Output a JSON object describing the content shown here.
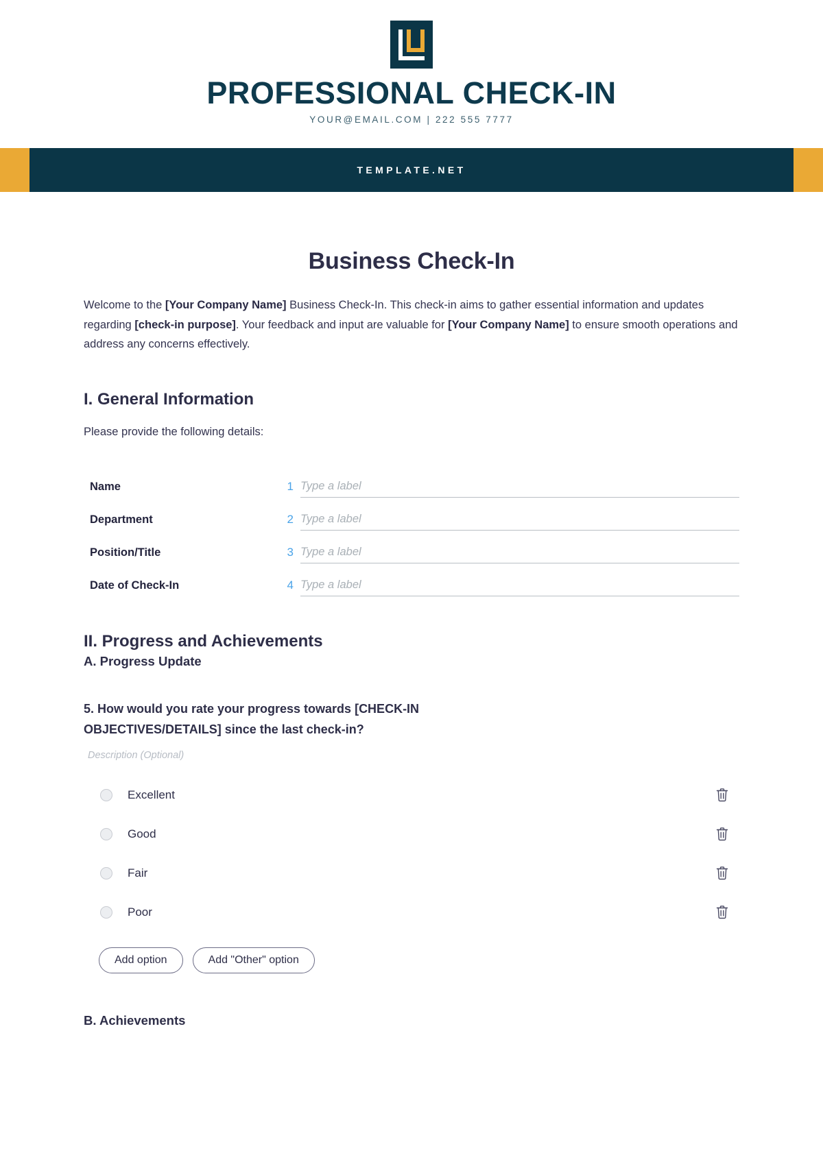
{
  "brand": {
    "logo_icon": "lu-monogram-logo",
    "title": "PROFESSIONAL CHECK-IN",
    "contact": "YOUR@EMAIL.COM | 222 555 7777"
  },
  "banner": {
    "text": "TEMPLATE.NET",
    "bar_color": "#0b3647",
    "accent_color": "#eaa935"
  },
  "document": {
    "title": "Business Check-In",
    "intro": {
      "p1": "Welcome to the ",
      "b1": "[Your Company Name]",
      "p2": " Business Check-In. This check-in aims to gather essential information and updates regarding ",
      "b2": "[check-in purpose]",
      "p3": ". Your feedback and input are valuable for ",
      "b3": "[Your Company Name]",
      "p4": " to ensure smooth operations and address any concerns effectively."
    }
  },
  "section_one": {
    "heading": "I. General Information",
    "subtitle": "Please provide the following details:",
    "fields": [
      {
        "label": "Name",
        "number": "1",
        "placeholder": "Type a label",
        "value": ""
      },
      {
        "label": "Department",
        "number": "2",
        "placeholder": "Type a label",
        "value": ""
      },
      {
        "label": "Position/Title",
        "number": "3",
        "placeholder": "Type a label",
        "value": ""
      },
      {
        "label": "Date of Check-In",
        "number": "4",
        "placeholder": "Type a label",
        "value": ""
      }
    ]
  },
  "section_two": {
    "heading": "II. Progress and Achievements",
    "sub_a": "A. Progress Update",
    "question_5": "5. How would you rate your progress towards [CHECK-IN OBJECTIVES/DETAILS] since the last check-in?",
    "description_placeholder": "Description (Optional)",
    "options": [
      {
        "label": "Excellent",
        "delete_icon": "trash-icon"
      },
      {
        "label": "Good",
        "delete_icon": "trash-icon"
      },
      {
        "label": "Fair",
        "delete_icon": "trash-icon"
      },
      {
        "label": "Poor",
        "delete_icon": "trash-icon"
      }
    ],
    "add_option_label": "Add option",
    "add_other_option_label": "Add \"Other\" option",
    "sub_b": "B. Achievements"
  },
  "colors": {
    "navy": "#0b3647",
    "gold": "#eaa935",
    "ink": "#2e2e48",
    "number_blue": "#4aa3e8",
    "placeholder_gray": "#a9b0b6"
  }
}
